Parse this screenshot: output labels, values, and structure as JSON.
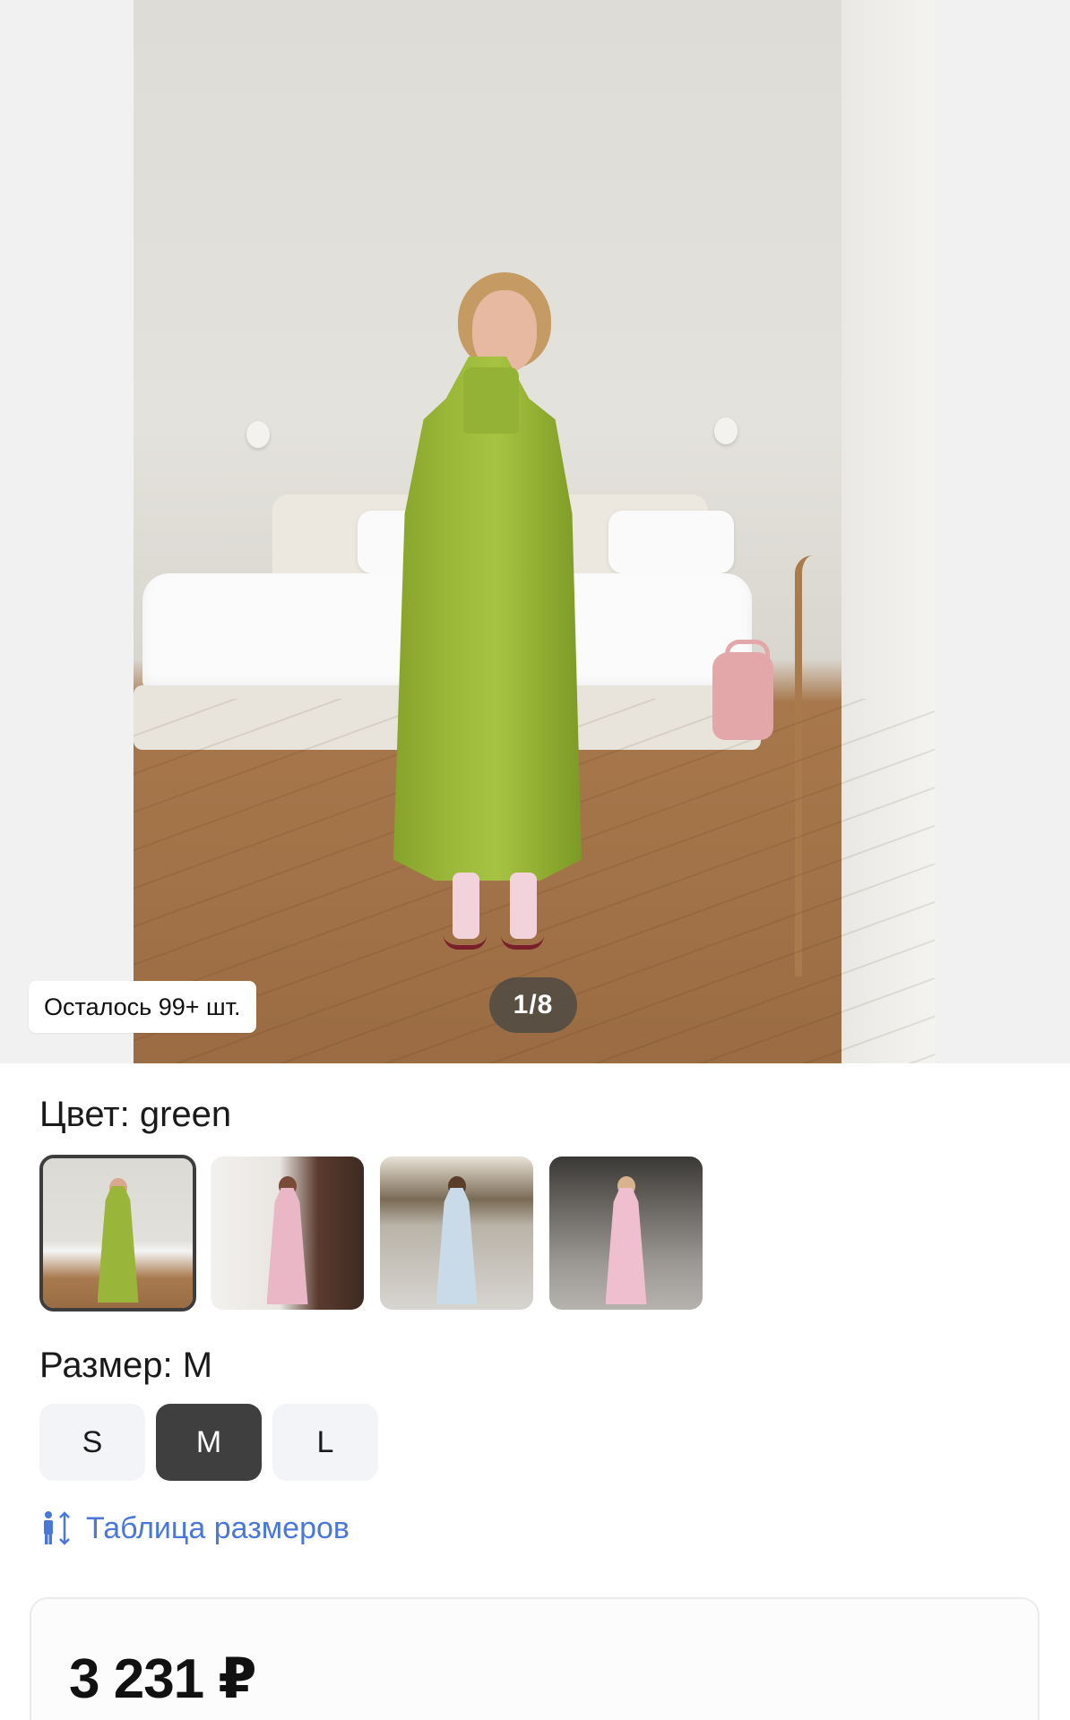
{
  "gallery": {
    "stock_label": "Осталось 99+ шт.",
    "counter": "1/8"
  },
  "color": {
    "label": "Цвет: green",
    "selected_index": 0,
    "swatches": [
      {
        "name": "green",
        "coat_color": "#9ab63a"
      },
      {
        "name": "pink",
        "coat_color": "#e9b7c6"
      },
      {
        "name": "light-blue",
        "coat_color": "#c9dbe8"
      },
      {
        "name": "pink-2",
        "coat_color": "#efbfcf"
      }
    ]
  },
  "size": {
    "label": "Размер: M",
    "options": [
      "S",
      "M",
      "L"
    ],
    "selected": "M"
  },
  "size_chart": {
    "label": "Таблица размеров"
  },
  "price": {
    "value": "3 231 ₽"
  },
  "colors": {
    "link": "#4a78d6",
    "selected_size_bg": "#3f3f3f",
    "size_bg": "#f2f4f7",
    "counter_bg": "#484642"
  }
}
